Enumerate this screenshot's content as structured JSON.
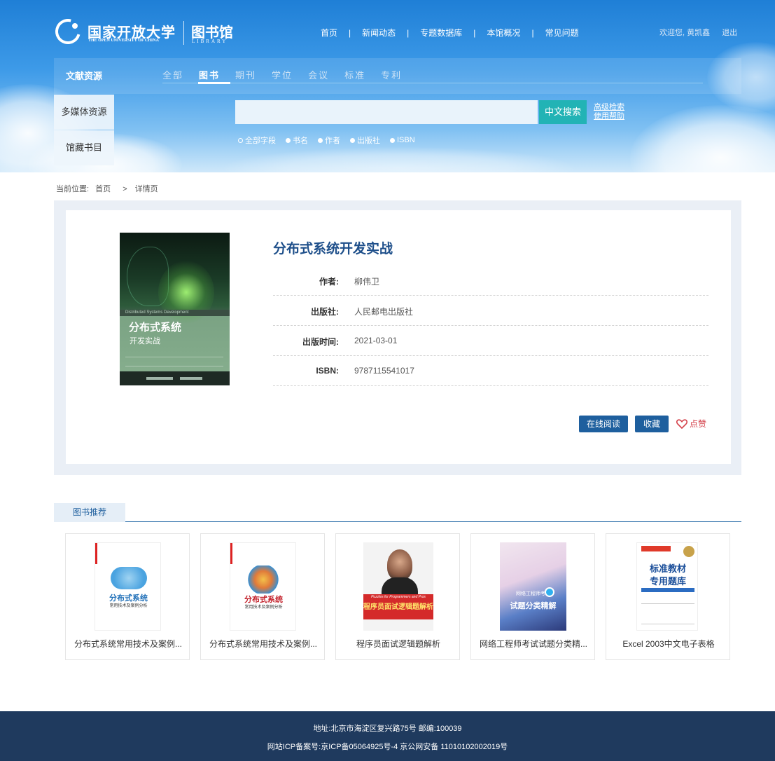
{
  "header": {
    "logo_cn": "国家开放大学",
    "logo_en": "THE OPEN UNIVERSITY OF CHINA",
    "library_cn": "图书馆",
    "library_en": "LIBRARY",
    "nav": [
      "首页",
      "新闻动态",
      "专题数据库",
      "本馆概况",
      "常见问题"
    ],
    "nav_sep": "|",
    "welcome": "欢迎您, 黄凯鑫",
    "logout": "退出"
  },
  "resources": {
    "title": "文献资源",
    "tabs": [
      "全部",
      "图书",
      "期刊",
      "学位",
      "会议",
      "标准",
      "专利"
    ],
    "active_tab": "图书",
    "side_items": [
      "多媒体资源",
      "馆藏书目"
    ]
  },
  "search": {
    "placeholder": "",
    "button": "中文搜索",
    "advanced": "高级检索",
    "help": "使用帮助",
    "fields": [
      "全部字段",
      "书名",
      "作者",
      "出版社",
      "ISBN"
    ],
    "selected_field": "全部字段"
  },
  "breadcrumb": {
    "label": "当前位置:",
    "home": "首页",
    "sep": ">",
    "current": "详情页"
  },
  "book": {
    "title": "分布式系统开发实战",
    "cover": {
      "band": "Distributed Systems Development",
      "title_main": "分布式系统",
      "title_sub": "开发实战"
    },
    "fields": [
      {
        "label": "作者:",
        "value": "柳伟卫"
      },
      {
        "label": "出版社:",
        "value": "人民邮电出版社"
      },
      {
        "label": "出版时间:",
        "value": "2021-03-01"
      },
      {
        "label": "ISBN:",
        "value": "9787115541017"
      }
    ],
    "actions": {
      "read": "在线阅读",
      "favorite": "收藏",
      "like": "点赞"
    }
  },
  "recommend": {
    "tab": "图书推荐",
    "items": [
      {
        "caption": "分布式系统常用技术及案例...",
        "cover_title": "分布式系统",
        "cover_sub": "常用技术及案例分析"
      },
      {
        "caption": "分布式系统常用技术及案例...",
        "cover_title": "分布式系统",
        "cover_sub": "常用技术及案例分析"
      },
      {
        "caption": "程序员面试逻辑题解析",
        "cover_title": "程序员面试逻辑题解析",
        "cover_sub": "Puzzles for Programmers and Pros"
      },
      {
        "caption": "网络工程师考试试题分类精...",
        "cover_title": "试题分类精解",
        "cover_sub": "网络工程师考试"
      },
      {
        "caption": "Excel 2003中文电子表格",
        "cover_title": "标准教材",
        "cover_sub": "专用题库"
      }
    ]
  },
  "footer": {
    "address": "地址:北京市海淀区复兴路75号 邮编:100039",
    "icp": "网站ICP备案号:京ICP备05064925号-4 京公网安备 11010102002019号"
  },
  "colors": {
    "primary": "#1e5f9e",
    "title": "#1e4f8a",
    "search_button": "#22b3b5",
    "footer": "#1f3a5e",
    "like": "#d4424b"
  }
}
